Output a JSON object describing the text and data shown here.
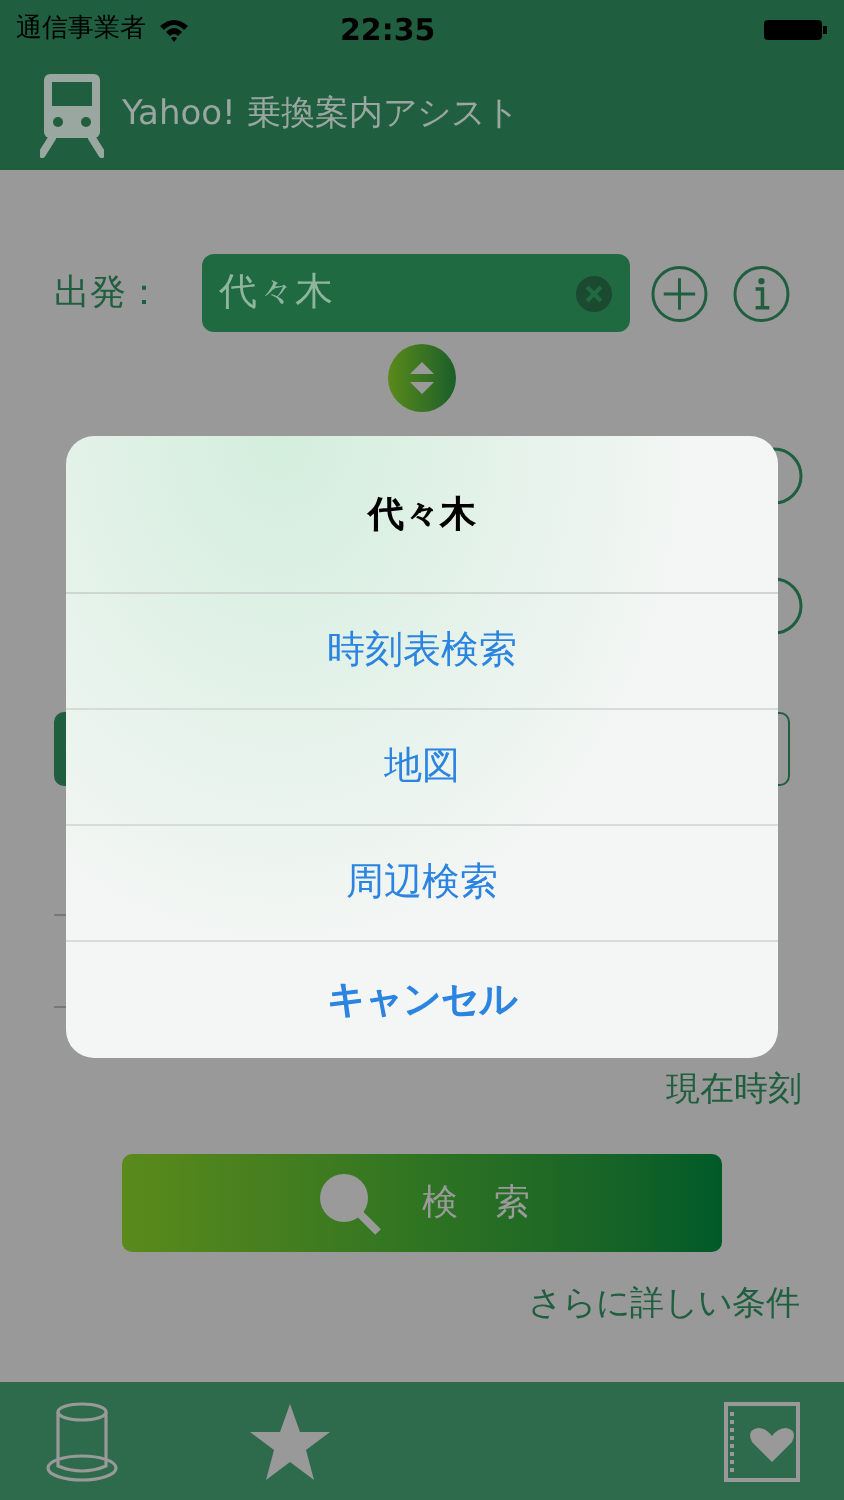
{
  "status_bar": {
    "carrier": "通信事業者",
    "time": "22:35"
  },
  "header": {
    "title": "Yahoo! 乗換案内アシスト"
  },
  "departure": {
    "label": "出発：",
    "value": "代々木"
  },
  "current_time_label": "現在時刻",
  "search_button": {
    "label": "検　索"
  },
  "more_conditions_link": "さらに詳しい条件",
  "action_sheet": {
    "title": "代々木",
    "actions": [
      {
        "label": "時刻表検索",
        "kind": "default"
      },
      {
        "label": "地図",
        "kind": "default"
      },
      {
        "label": "周辺検索",
        "kind": "default"
      },
      {
        "label": "キャンセル",
        "kind": "cancel"
      }
    ]
  },
  "tab_bar": {
    "items": [
      {
        "kind": "hat"
      },
      {
        "kind": "star"
      },
      {
        "kind": "notebook"
      }
    ]
  }
}
